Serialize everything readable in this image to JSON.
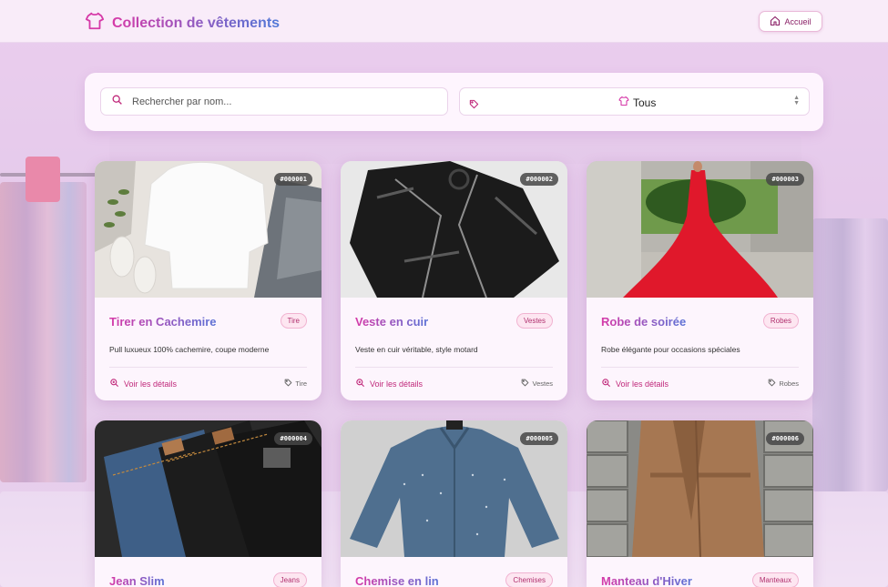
{
  "header": {
    "title": "Collection de vêtements",
    "home_label": "Accueil",
    "brand_icon": "shirt-icon",
    "home_icon": "home-icon"
  },
  "filters": {
    "search_placeholder": "Rechercher par nom...",
    "category_selected": "Tous"
  },
  "products": [
    {
      "id": "#000001",
      "name": "Tirer en Cachemire",
      "category": "Tire",
      "description": "Pull luxueux 100% cachemire, coupe moderne",
      "details_label": "Voir les détails"
    },
    {
      "id": "#000002",
      "name": "Veste en cuir",
      "category": "Vestes",
      "description": "Veste en cuir véritable, style motard",
      "details_label": "Voir les détails"
    },
    {
      "id": "#000003",
      "name": "Robe de soirée",
      "category": "Robes",
      "description": "Robe élégante pour occasions spéciales",
      "details_label": "Voir les détails"
    },
    {
      "id": "#000004",
      "name": "Jean Slim",
      "category": "Jeans",
      "description": "",
      "details_label": ""
    },
    {
      "id": "#000005",
      "name": "Chemise en lin",
      "category": "Chemises",
      "description": "",
      "details_label": ""
    },
    {
      "id": "#000006",
      "name": "Manteau d'Hiver",
      "category": "Manteaux",
      "description": "",
      "details_label": ""
    }
  ],
  "colors": {
    "accent": "#d63aa8",
    "accent_blue": "#4f79d8",
    "badge_bg": "#fde6f1"
  }
}
